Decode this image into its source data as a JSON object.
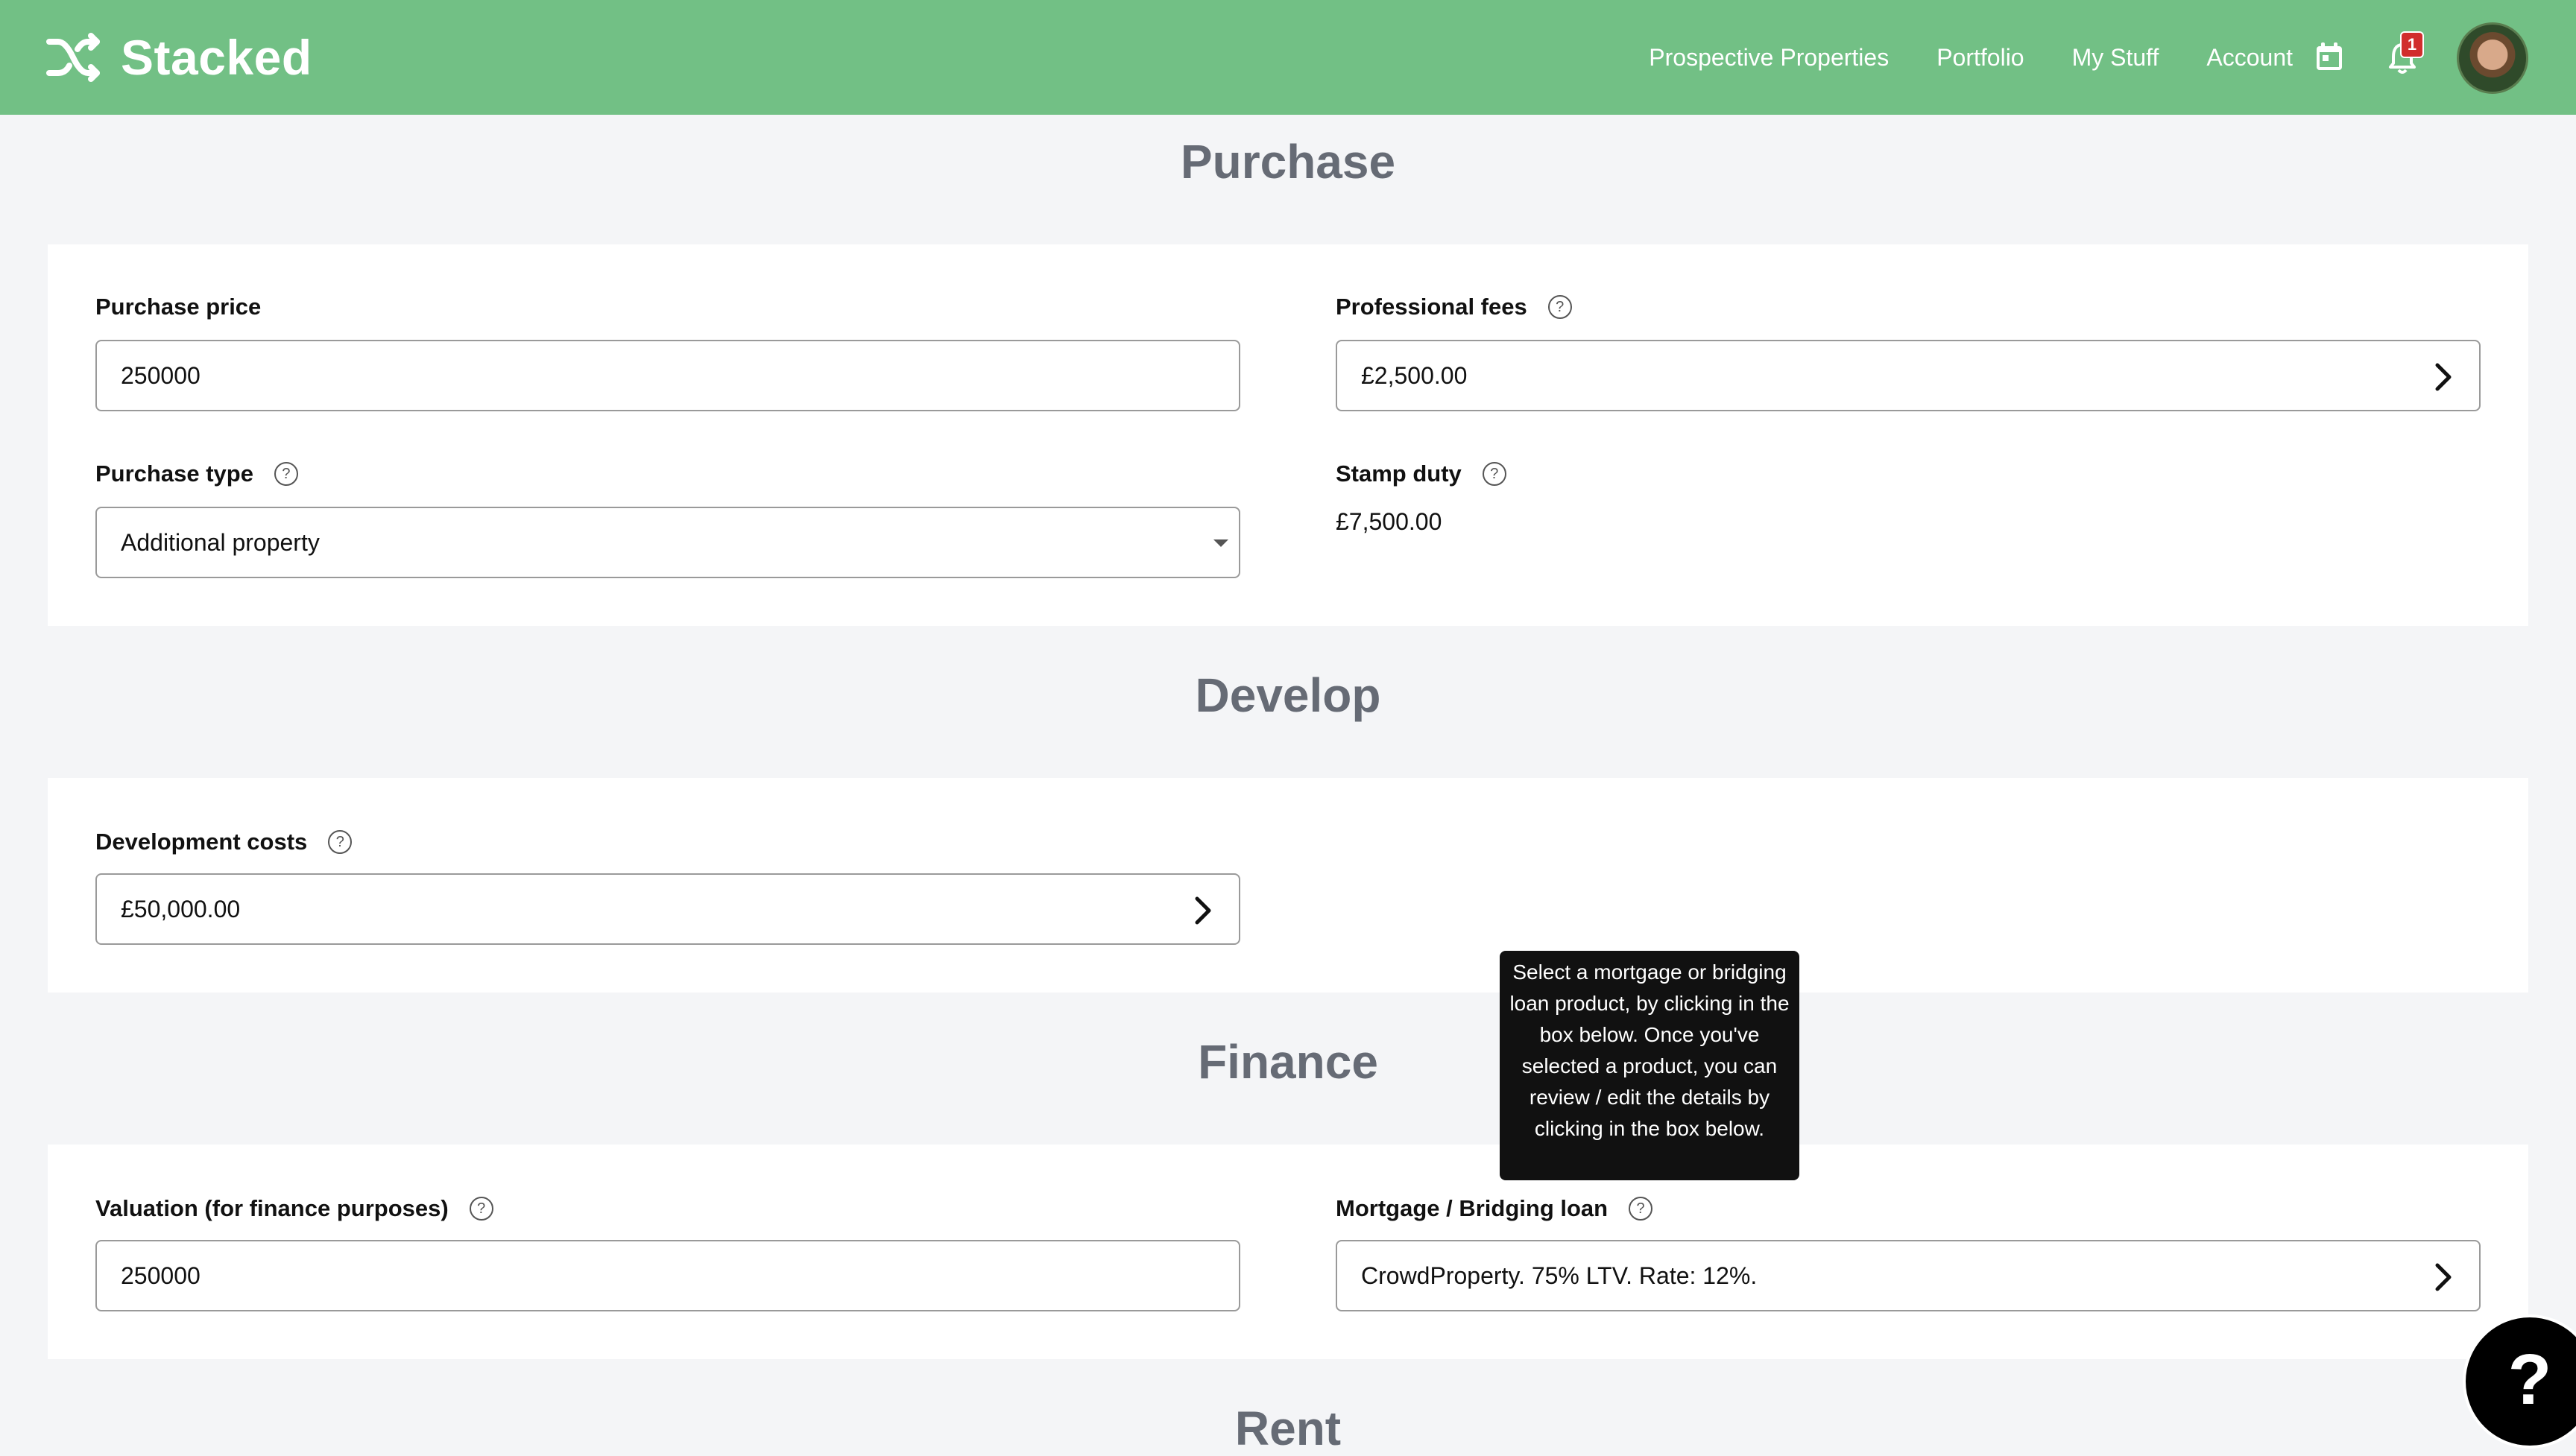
{
  "app": {
    "brand": "Stacked"
  },
  "nav": {
    "items": [
      "Prospective Properties",
      "Portfolio",
      "My Stuff",
      "Account"
    ],
    "notification_count": "1"
  },
  "purchase": {
    "title": "Purchase",
    "purchase_price_label": "Purchase price",
    "purchase_price_value": "250000",
    "professional_fees_label": "Professional fees",
    "professional_fees_value": "£2,500.00",
    "purchase_type_label": "Purchase type",
    "purchase_type_value": "Additional property",
    "stamp_duty_label": "Stamp duty",
    "stamp_duty_value": "£7,500.00"
  },
  "develop": {
    "title": "Develop",
    "development_costs_label": "Development costs",
    "development_costs_value": "£50,000.00"
  },
  "finance": {
    "title": "Finance",
    "valuation_label": "Valuation (for finance purposes)",
    "valuation_value": "250000",
    "mortgage_label": "Mortgage / Bridging loan",
    "mortgage_value": "CrowdProperty. 75% LTV. Rate: 12%.",
    "tooltip": "Select a mortgage or bridging loan product, by clicking in the box below. Once you've selected a product, you can review / edit the details by clicking in the box below."
  },
  "rent": {
    "title": "Rent"
  },
  "help_button": "?",
  "help_glyph": "?",
  "icons": [
    "shuffle-logo-icon",
    "calendar-icon",
    "bell-icon",
    "chevron-right-icon",
    "caret-down-icon",
    "question-circle-icon"
  ]
}
